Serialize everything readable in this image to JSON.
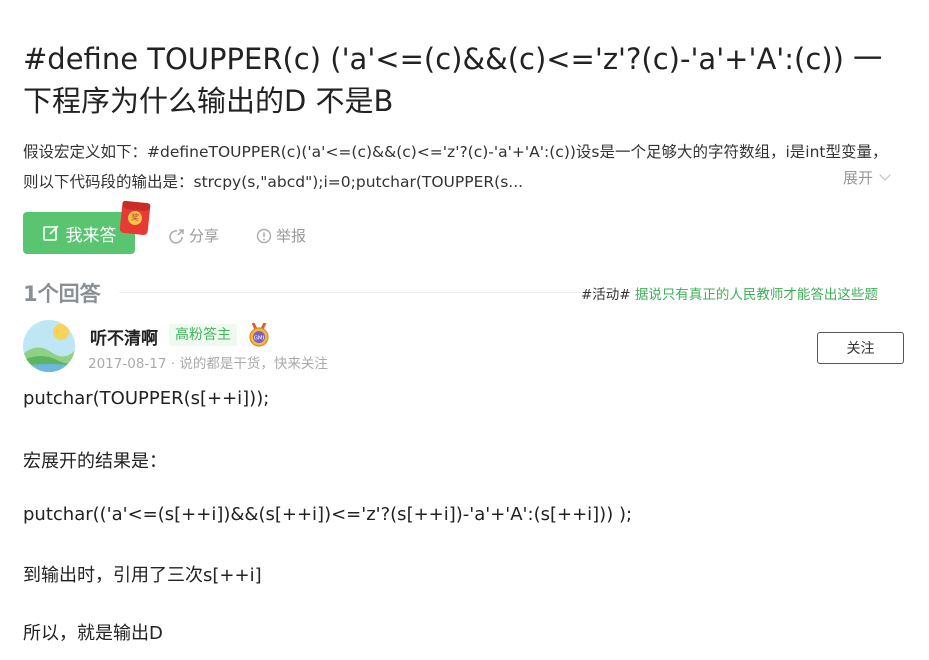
{
  "question": {
    "title": "#define TOUPPER(c) ('a'<=(c)&&(c)<='z'?(c)-'a'+'A':(c)) 一下程序为什么输出的D 不是B",
    "description": "假设宏定义如下：#defineTOUPPER(c)('a'<=(c)&&(c)<='z'?(c)-'a'+'A':(c))设s是一个足够大的字符数组，i是int型变量，则以下代码段的输出是：strcpy(s,\"abcd\");i=0;putchar(TOUPPER(s...",
    "expand_label": "展开"
  },
  "actions": {
    "answer_label": "我来答",
    "redpacket_text": "奖",
    "share_label": "分享",
    "report_label": "举报"
  },
  "answers_header": {
    "count_label": "1个回答",
    "activity_tag": "#活动#",
    "activity_link": "据说只有真正的人民教师才能答出这些题"
  },
  "answer": {
    "username": "听不清啊",
    "badge": "高粉答主",
    "medal_text": "GMI",
    "meta": "2017-08-17 · 说的都是干货，快来关注",
    "follow_label": "关注",
    "lines": [
      "putchar(TOUPPER(s[++i]));",
      "宏展开的结果是：",
      "putchar(('a'<=(s[++i])&&(s[++i])<='z'?(s[++i])-'a'+'A':(s[++i])) );",
      "到输出时，引用了三次s[++i]",
      "所以，就是输出D"
    ]
  },
  "colors": {
    "accent_green": "#5ac570",
    "link_green": "#3eaf57",
    "muted": "#999999"
  }
}
